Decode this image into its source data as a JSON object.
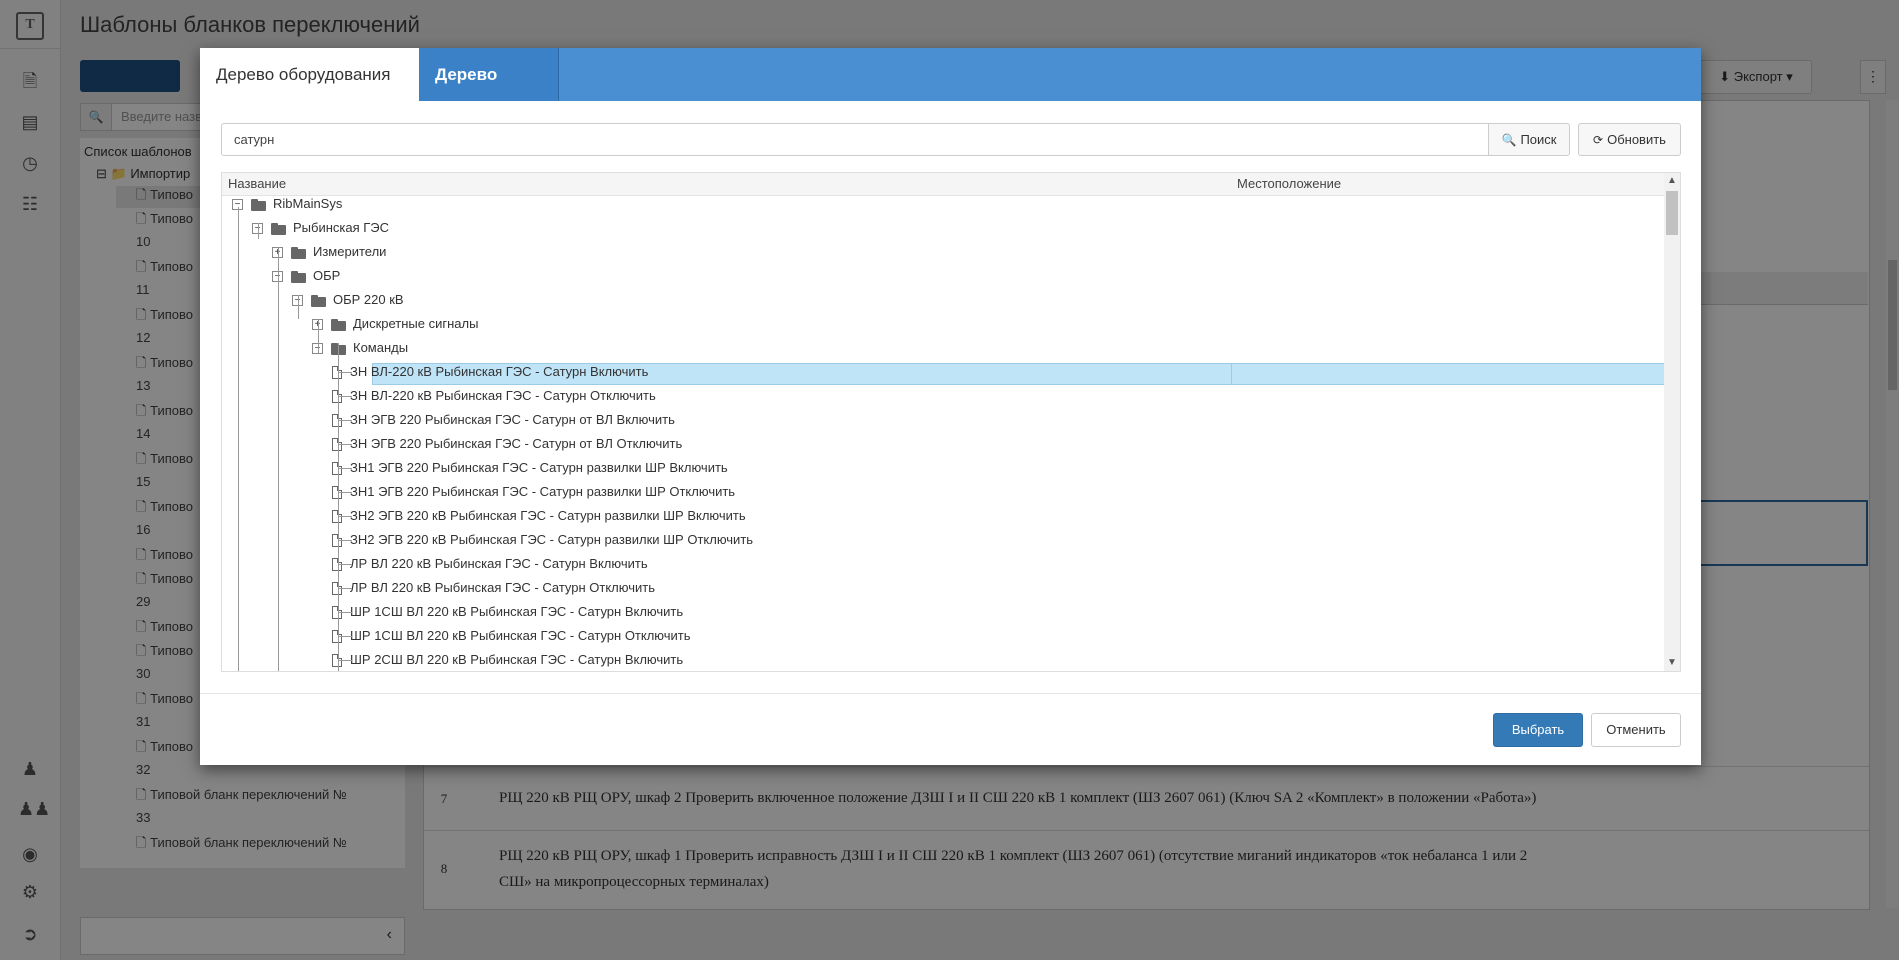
{
  "page": {
    "title": "Шаблоны бланков переключений"
  },
  "rail": {
    "logo": "T",
    "icons_top": [
      "document-icon",
      "list-icon",
      "clock-icon",
      "database-icon"
    ],
    "icons_bottom": [
      "user-icon",
      "users-icon",
      "eye-icon",
      "gear-icon",
      "logout-icon"
    ]
  },
  "background": {
    "export_label": "Экспорт",
    "menu_label": "⋮",
    "search_placeholder": "Введите назв",
    "list_header": "Список шаблонов",
    "imported_label": "Импортир",
    "left_items": [
      "Типово",
      "Типово",
      "10",
      "Типово",
      "11",
      "Типово",
      "12",
      "Типово",
      "13",
      "Типово",
      "14",
      "Типово",
      "15",
      "Типово",
      "16",
      "Типово",
      "Типово",
      "29",
      "Типово",
      "Типово",
      "30",
      "Типово",
      "31",
      "Типово",
      "32",
      "Типовой бланк переключений №",
      "33",
      "Типовой бланк переключений №"
    ],
    "rows": [
      {
        "num": "7",
        "text": "РЩ 220 кВ РЩ ОРУ, шкаф 2 Проверить включенное положение ДЗШ I и II СШ 220 кВ 1 комплект (ШЗ 2607 061) (Ключ SA 2 «Комплект» в положении «Работа»)"
      },
      {
        "num": "8",
        "text": "РЩ 220 кВ РЩ ОРУ, шкаф 1 Проверить исправность ДЗШ I и II СШ 220 кВ 1 комплект (ШЗ 2607 061) (отсутствие миганий индикаторов «ток небаланса 1 или 2"
      },
      {
        "num": "",
        "text": "СШ» на микропроцессорных терминалах)"
      }
    ]
  },
  "modal": {
    "tabs": [
      {
        "label": "Дерево оборудования",
        "active": true
      },
      {
        "label": "Дерево тегов",
        "active": false
      }
    ],
    "search_value": "сатурн",
    "search_button": "Поиск",
    "refresh_button": "Обновить",
    "columns": {
      "name": "Название",
      "location": "Местоположение"
    },
    "tree": [
      {
        "label": "RibMainSys",
        "kind": "folder",
        "toggle": "−"
      },
      {
        "label": "Рыбинская ГЭС",
        "kind": "folder",
        "toggle": "−"
      },
      {
        "label": "Измерители",
        "kind": "folder",
        "toggle": "+"
      },
      {
        "label": "ОБР",
        "kind": "folder",
        "toggle": "−"
      },
      {
        "label": "ОБР 220 кВ",
        "kind": "folder",
        "toggle": "−"
      },
      {
        "label": "Дискретные сигналы",
        "kind": "folder",
        "toggle": "+"
      },
      {
        "label": "Команды",
        "kind": "folder",
        "toggle": "−"
      },
      {
        "label": "ЗН ВЛ-220 кВ Рыбинская ГЭС - Сатурн Включить",
        "kind": "doc",
        "selected": true
      },
      {
        "label": "ЗН ВЛ-220 кВ Рыбинская ГЭС - Сатурн Отключить",
        "kind": "doc"
      },
      {
        "label": "ЗН ЭГВ 220 Рыбинская ГЭС - Сатурн от ВЛ Включить",
        "kind": "doc"
      },
      {
        "label": "ЗН ЭГВ 220 Рыбинская ГЭС - Сатурн от ВЛ Отключить",
        "kind": "doc"
      },
      {
        "label": "ЗН1 ЭГВ 220 Рыбинская ГЭС - Сатурн развилки ШР Включить",
        "kind": "doc"
      },
      {
        "label": "ЗН1 ЭГВ 220 Рыбинская ГЭС - Сатурн развилки ШР Отключить",
        "kind": "doc"
      },
      {
        "label": "ЗН2 ЭГВ 220 кВ Рыбинская ГЭС - Сатурн развилки ШР Включить",
        "kind": "doc"
      },
      {
        "label": "ЗН2 ЭГВ 220 кВ Рыбинская ГЭС - Сатурн развилки ШР Отключить",
        "kind": "doc"
      },
      {
        "label": "ЛР ВЛ 220 кВ Рыбинская ГЭС - Сатурн Включить",
        "kind": "doc"
      },
      {
        "label": "ЛР ВЛ 220 кВ Рыбинская ГЭС - Сатурн Отключить",
        "kind": "doc"
      },
      {
        "label": "ШР 1СШ ВЛ 220 кВ Рыбинская ГЭС - Сатурн Включить",
        "kind": "doc"
      },
      {
        "label": "ШР 1СШ ВЛ 220 кВ Рыбинская ГЭС - Сатурн Отключить",
        "kind": "doc"
      },
      {
        "label": "ШР 2СШ ВЛ 220 кВ Рыбинская ГЭС - Сатурн Включить",
        "kind": "doc"
      }
    ],
    "select_button": "Выбрать",
    "cancel_button": "Отменить"
  },
  "colors": {
    "header_blue": "#4a8fd1",
    "primary": "#337ab7",
    "selected_row": "#bfe3f7"
  }
}
